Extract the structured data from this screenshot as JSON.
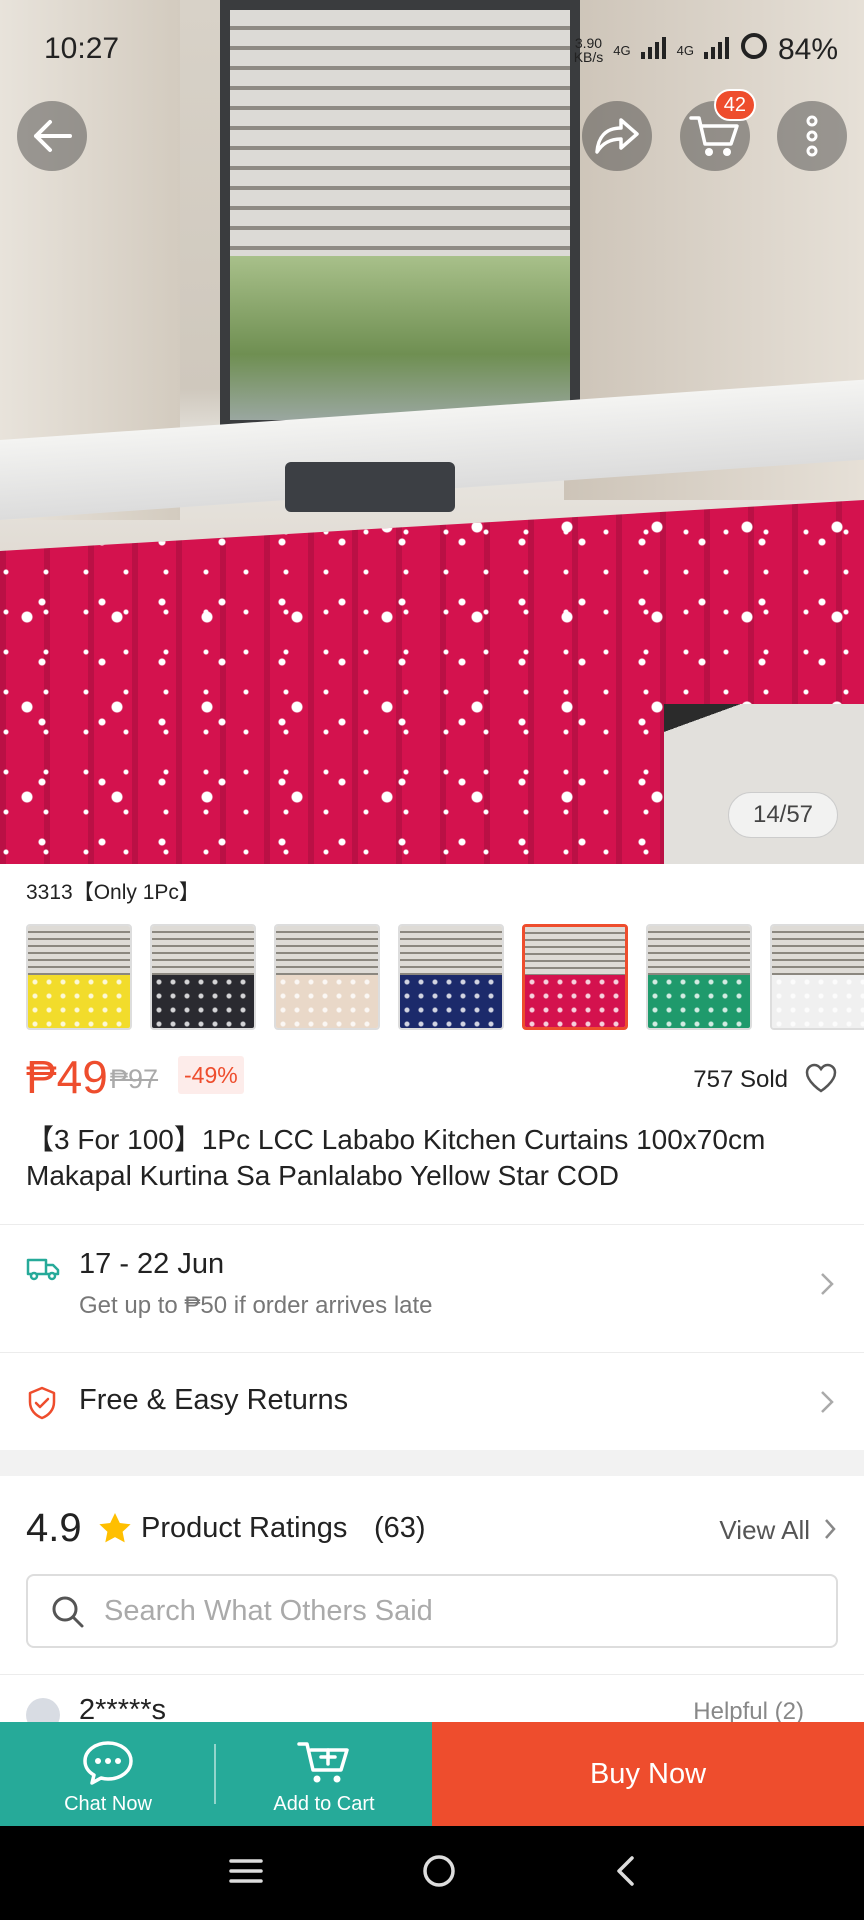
{
  "status_bar": {
    "time": "10:27",
    "speed": "3.90",
    "speed_unit": "KB/s",
    "network_1": "4G",
    "network_2": "4G",
    "battery": "84%"
  },
  "header": {
    "cart_count": "42"
  },
  "gallery": {
    "counter": "14/57"
  },
  "variation": {
    "label": "3313【Only 1Pc】",
    "thumbnails": [
      {
        "color": "#f2dc2b"
      },
      {
        "color": "#2a2a30"
      },
      {
        "color": "#e9d8c8"
      },
      {
        "color": "#1c2a6b"
      },
      {
        "color": "#d4124e"
      },
      {
        "color": "#1f9a6c"
      },
      {
        "color": "#f0f0f0"
      }
    ],
    "selected_index": 4
  },
  "product": {
    "price": "₱49",
    "original_price": "₱97",
    "discount": "-49%",
    "sold": "757 Sold",
    "title": "【3 For 100】1Pc LCC Lababo Kitchen Curtains 100x70cm Makapal Kurtina Sa Panlalabo Yellow Star COD"
  },
  "shipping": {
    "date_range": "17 - 22 Jun",
    "guarantee": "Get up to ₱50 if order arrives late"
  },
  "returns": {
    "label": "Free & Easy Returns"
  },
  "ratings": {
    "score": "4.9",
    "title": "Product Ratings",
    "count": "(63)",
    "view_all": "View All",
    "search_placeholder": "Search What Others Said"
  },
  "review_preview": {
    "user": "2*****s",
    "helpful": "Helpful (2)"
  },
  "action_bar": {
    "chat_label": "Chat Now",
    "cart_label": "Add to Cart",
    "buy_label": "Buy Now"
  },
  "colors": {
    "brand": "#ee4d2d",
    "teal": "#26aa99"
  }
}
